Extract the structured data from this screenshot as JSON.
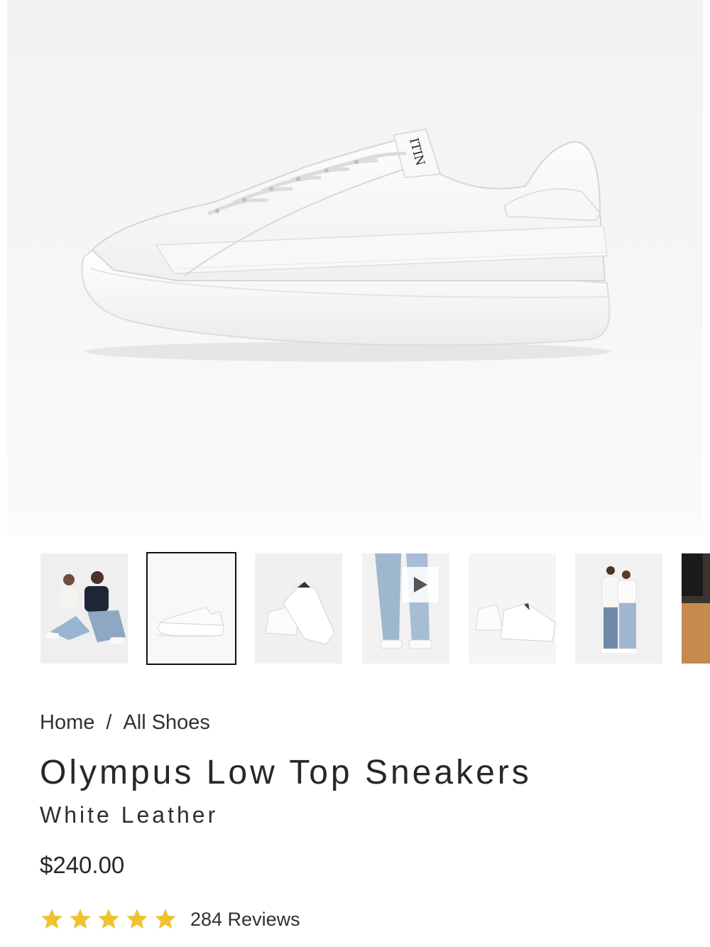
{
  "product_image": {
    "brand_mark": "ITIN"
  },
  "thumbnails": [
    {
      "kind": "lifestyle-seated-couple",
      "selected": false
    },
    {
      "kind": "shoe-side",
      "selected": true
    },
    {
      "kind": "shoe-pair-angle",
      "selected": false
    },
    {
      "kind": "video-on-feet",
      "selected": false,
      "play_icon": "play-icon"
    },
    {
      "kind": "shoe-pair-back",
      "selected": false
    },
    {
      "kind": "lifestyle-standing-couple",
      "selected": false
    },
    {
      "kind": "partial-next",
      "selected": false
    }
  ],
  "breadcrumb": {
    "home": "Home",
    "separator": "/",
    "category": "All Shoes"
  },
  "product": {
    "title": "Olympus Low Top Sneakers",
    "variant": "White Leather",
    "price": "$240.00"
  },
  "rating": {
    "stars": 5,
    "star_color": "#f0c230",
    "reviews_label": "284 Reviews"
  }
}
